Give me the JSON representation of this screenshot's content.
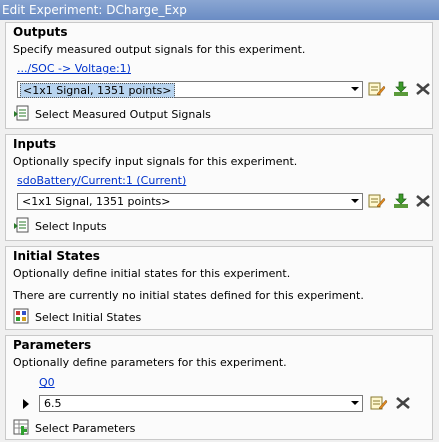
{
  "window": {
    "title": "Edit Experiment: DCharge_Exp"
  },
  "outputs": {
    "title": "Outputs",
    "description": "Specify measured output signals for this experiment.",
    "signal_link": ".../SOC -> Voltage:1)",
    "value": "<1x1 Signal, 1351 points>",
    "select_button": "Select Measured Output Signals"
  },
  "inputs": {
    "title": "Inputs",
    "description": "Optionally specify input signals for this experiment.",
    "signal_link": "sdoBattery/Current:1 (Current)",
    "value": "<1x1 Signal, 1351 points>",
    "select_button": "Select Inputs"
  },
  "initial_states": {
    "title": "Initial States",
    "description": "Optionally define initial states for this experiment.",
    "status": "There are currently no initial states defined for this experiment.",
    "select_button": "Select Initial States"
  },
  "parameters": {
    "title": "Parameters",
    "description": "Optionally define parameters for this experiment.",
    "param_name": "Q0",
    "value": "6.5",
    "select_button": "Select Parameters"
  }
}
